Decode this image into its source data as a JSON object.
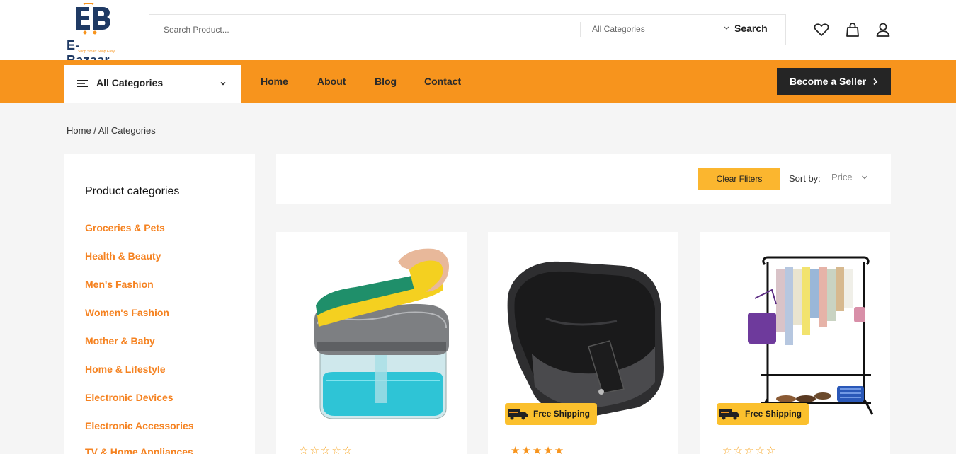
{
  "header": {
    "logo_mark": "EB",
    "logo_name": "E-Bazaar",
    "logo_tagline": "Shop Smart Shop Easy",
    "search_placeholder": "Search Product...",
    "category_select": "All Categories",
    "search_button": "Search",
    "icons": [
      "heart-icon",
      "shopping-bag-icon",
      "user-icon"
    ]
  },
  "nav": {
    "all_categories": "All Categories",
    "links": [
      "Home",
      "About",
      "Blog",
      "Contact"
    ],
    "seller_button": "Become a Seller"
  },
  "breadcrumb": {
    "home": "Home",
    "separator": " / ",
    "current": "All Categories"
  },
  "sidebar": {
    "title": "Product categories",
    "categories": [
      "Groceries & Pets",
      "Health & Beauty",
      "Men's Fashion",
      "Women's Fashion",
      "Mother & Baby",
      "Home & Lifestyle",
      "Electronic Devices",
      "Electronic Accessories",
      "TV & Home Appliances"
    ]
  },
  "filters": {
    "clear_button": "Clear Fliters",
    "sort_label": "Sort by:",
    "sort_value": "Price"
  },
  "products": [
    {
      "image": "soap-dispenser-sponge",
      "badge": "",
      "rating_stars": "☆☆☆☆☆"
    },
    {
      "image": "black-backpack",
      "badge": "Free Shipping",
      "rating_stars": "★★★★★"
    },
    {
      "image": "clothes-rack",
      "badge": "Free Shipping",
      "rating_stars": "☆☆☆☆☆"
    }
  ],
  "colors": {
    "accent": "#f7941d",
    "category_link": "#f58220",
    "badge": "#fbc02d",
    "clear_button": "#fbb62f",
    "dark_button": "#252525",
    "brand_blue": "#1f3a64"
  }
}
